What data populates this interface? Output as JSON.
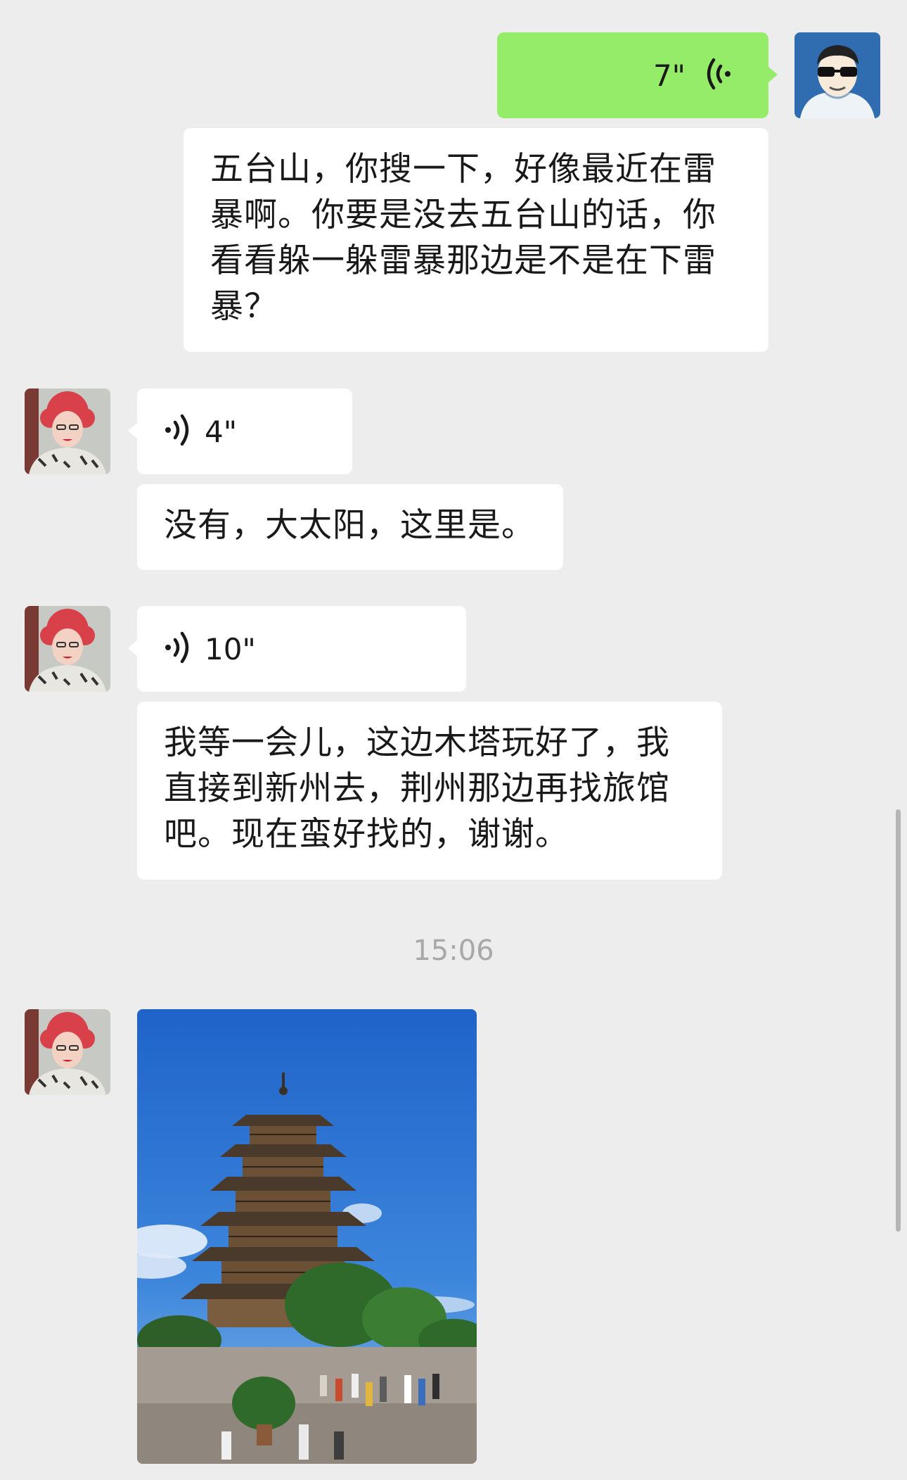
{
  "chat": {
    "messages": [
      {
        "sender": "me",
        "type": "voice",
        "duration": "7\""
      },
      {
        "sender": "me",
        "type": "text",
        "text": "五台山，你搜一下，好像最近在雷暴啊。你要是没去五台山的话，你看看躲一躲雷暴那边是不是在下雷暴？"
      },
      {
        "sender": "other",
        "type": "voice",
        "duration": "4\""
      },
      {
        "sender": "other",
        "type": "text",
        "text": "没有，大太阳，这里是。"
      },
      {
        "sender": "other",
        "type": "voice",
        "duration": "10\""
      },
      {
        "sender": "other",
        "type": "text",
        "text": "我等一会儿，这边木塔玩好了，我直接到新州去，荆州那边再找旅馆吧。现在蛮好找的，谢谢。"
      },
      {
        "sender": "other",
        "type": "image",
        "subject": "wooden-pagoda-photo"
      }
    ],
    "timestamp": "15:06"
  },
  "colors": {
    "background": "#ededed",
    "my_bubble": "#95ec69",
    "their_bubble": "#ffffff",
    "timestamp_text": "#a8a8a8"
  },
  "icons": {
    "voice_in": "voice-wave-icon",
    "voice_out": "voice-wave-icon"
  }
}
